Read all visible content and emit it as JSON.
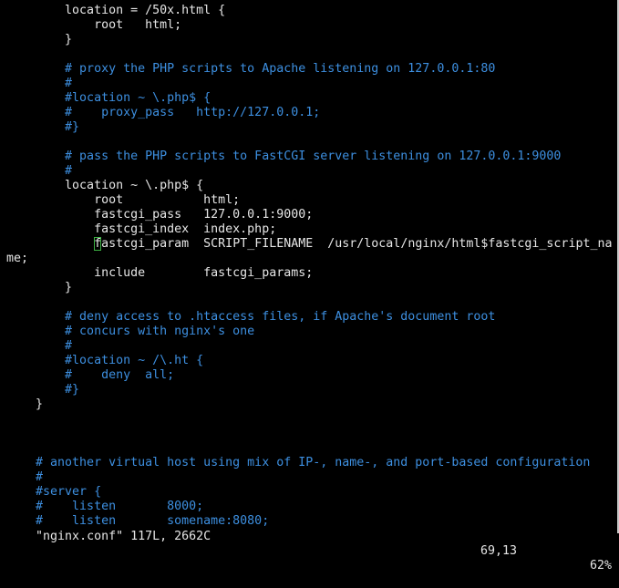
{
  "editor": {
    "theme_colors": {
      "background": "#000000",
      "text": "#e6e6e6",
      "comment": "#3d8fe0",
      "cursor": "#3cb043"
    },
    "lines": [
      {
        "text": "        location = /50x.html {",
        "type": "normal"
      },
      {
        "text": "            root   html;",
        "type": "normal"
      },
      {
        "text": "        }",
        "type": "normal"
      },
      {
        "text": "",
        "type": "normal"
      },
      {
        "text": "        # proxy the PHP scripts to Apache listening on 127.0.0.1:80",
        "type": "comment"
      },
      {
        "text": "        #",
        "type": "comment"
      },
      {
        "text": "        #location ~ \\.php$ {",
        "type": "comment"
      },
      {
        "text": "        #    proxy_pass   http://127.0.0.1;",
        "type": "comment"
      },
      {
        "text": "        #}",
        "type": "comment"
      },
      {
        "text": "",
        "type": "normal"
      },
      {
        "text": "        # pass the PHP scripts to FastCGI server listening on 127.0.0.1:9000",
        "type": "comment"
      },
      {
        "text": "        #",
        "type": "comment"
      },
      {
        "text": "        location ~ \\.php$ {",
        "type": "normal"
      },
      {
        "text": "            root           html;",
        "type": "normal"
      },
      {
        "text": "            fastcgi_pass   127.0.0.1:9000;",
        "type": "normal"
      },
      {
        "text": "            fastcgi_index  index.php;",
        "type": "normal"
      },
      {
        "text": "            fastcgi_param  SCRIPT_FILENAME  /usr/local/nginx/html$fastcgi_script_na",
        "type": "normal",
        "cursor_col": 12
      },
      {
        "text": "me;",
        "type": "normal"
      },
      {
        "text": "            include        fastcgi_params;",
        "type": "normal"
      },
      {
        "text": "        }",
        "type": "normal"
      },
      {
        "text": "",
        "type": "normal"
      },
      {
        "text": "        # deny access to .htaccess files, if Apache's document root",
        "type": "comment"
      },
      {
        "text": "        # concurs with nginx's one",
        "type": "comment"
      },
      {
        "text": "        #",
        "type": "comment"
      },
      {
        "text": "        #location ~ /\\.ht {",
        "type": "comment"
      },
      {
        "text": "        #    deny  all;",
        "type": "comment"
      },
      {
        "text": "        #}",
        "type": "comment"
      },
      {
        "text": "    }",
        "type": "normal"
      },
      {
        "text": "",
        "type": "normal"
      },
      {
        "text": "",
        "type": "normal"
      },
      {
        "text": "",
        "type": "normal"
      },
      {
        "text": "    # another virtual host using mix of IP-, name-, and port-based configuration",
        "type": "comment"
      },
      {
        "text": "    #",
        "type": "comment"
      },
      {
        "text": "    #server {",
        "type": "comment"
      },
      {
        "text": "    #    listen       8000;",
        "type": "comment"
      },
      {
        "text": "    #    listen       somename:8080;",
        "type": "comment"
      }
    ]
  },
  "status": {
    "file_info": "\"nginx.conf\" 117L, 2662C",
    "cursor_position": "69,13",
    "scroll_percent": "62%"
  }
}
